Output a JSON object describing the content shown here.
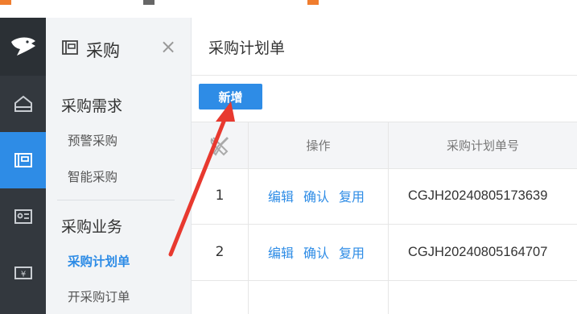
{
  "menu": {
    "title": "采购",
    "close_glyph": "×",
    "groups": [
      {
        "label": "采购需求",
        "items": [
          {
            "label": "预警采购"
          },
          {
            "label": "智能采购"
          }
        ]
      },
      {
        "label": "采购业务",
        "items": [
          {
            "label": "采购计划单",
            "active": true
          },
          {
            "label": "开采购订单"
          }
        ]
      }
    ]
  },
  "rail": {
    "icons": [
      "logo-icon",
      "home-icon",
      "purchase-icon",
      "contact-card-icon",
      "money-icon"
    ],
    "active_index": 2
  },
  "page": {
    "title": "采购计划单",
    "add_button": "新增"
  },
  "table": {
    "columns": [
      "操作",
      "采购计划单号"
    ],
    "settings_icon": "wrench-screwdriver-icon",
    "rows": [
      {
        "index": "1",
        "actions": [
          "编辑",
          "确认",
          "复用"
        ],
        "code": "CGJH20240805173639"
      },
      {
        "index": "2",
        "actions": [
          "编辑",
          "确认",
          "复用"
        ],
        "code": "CGJH20240805164707"
      }
    ]
  },
  "colors": {
    "accent": "#2e8ce6",
    "rail_bg": "#33383e",
    "annotation_arrow": "#e8392f"
  }
}
